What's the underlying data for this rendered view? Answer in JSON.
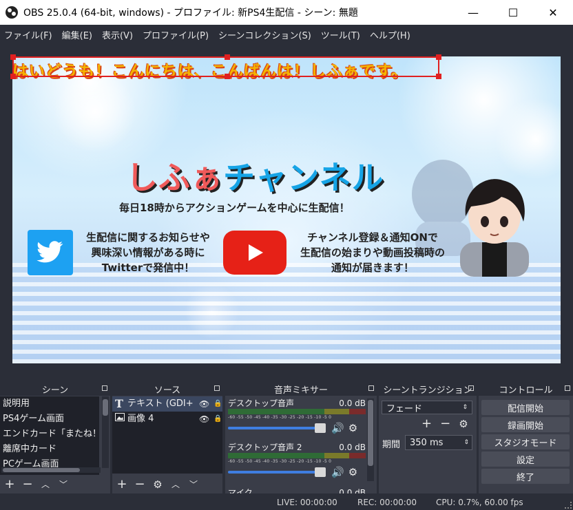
{
  "window": {
    "title": "OBS 25.0.4 (64-bit, windows) - プロファイル: 新PS4生配信 - シーン: 無題",
    "minimize": "—",
    "maximize": "☐",
    "close": "✕"
  },
  "menu": [
    "ファイル(F)",
    "編集(E)",
    "表示(V)",
    "プロファイル(P)",
    "シーンコレクション(S)",
    "ツール(T)",
    "ヘルプ(H)"
  ],
  "preview": {
    "overlay_text": "はいどうも！こんにちは、こんばんは！しふぁです。",
    "channel_title_a": "しふぁ",
    "channel_title_b": "チャンネル",
    "tagline": "毎日18時からアクションゲームを中心に生配信！",
    "twitter_lines": [
      "生配信に関するお知らせや",
      "興味深い情報がある時に",
      "Twitterで発信中！"
    ],
    "youtube_lines": [
      "チャンネル登録＆通知ONで",
      "生配信の始まりや動画投稿時の",
      "通知が届きます！"
    ]
  },
  "scenes": {
    "title": "シーン",
    "items": [
      "説明用",
      "PS4ゲーム画面",
      "エンドカード「またね！」PS",
      "離席中カード",
      "PCゲーム画面"
    ]
  },
  "sources": {
    "title": "ソース",
    "items": [
      {
        "icon": "text-icon",
        "label": "テキスト (GDI+"
      },
      {
        "icon": "image-icon",
        "label": "画像 4"
      }
    ]
  },
  "mixer": {
    "title": "音声ミキサー",
    "ticks": "-60 -55 -50 -45 -40 -35 -30 -25 -20 -15 -10 -5 0",
    "channels": [
      {
        "name": "デスクトップ音声",
        "db": "0.0 dB"
      },
      {
        "name": "デスクトップ音声 2",
        "db": "0.0 dB"
      },
      {
        "name": "マイク",
        "db": "0.0 dB"
      }
    ]
  },
  "transitions": {
    "title": "シーントランジション",
    "selected": "フェード",
    "duration_label": "期間",
    "duration_value": "350 ms"
  },
  "controls": {
    "title": "コントロール",
    "buttons": [
      "配信開始",
      "録画開始",
      "スタジオモード",
      "設定",
      "終了"
    ]
  },
  "status": {
    "live": "LIVE: 00:00:00",
    "rec": "REC: 00:00:00",
    "cpu": "CPU: 0.7%, 60.00 fps"
  }
}
